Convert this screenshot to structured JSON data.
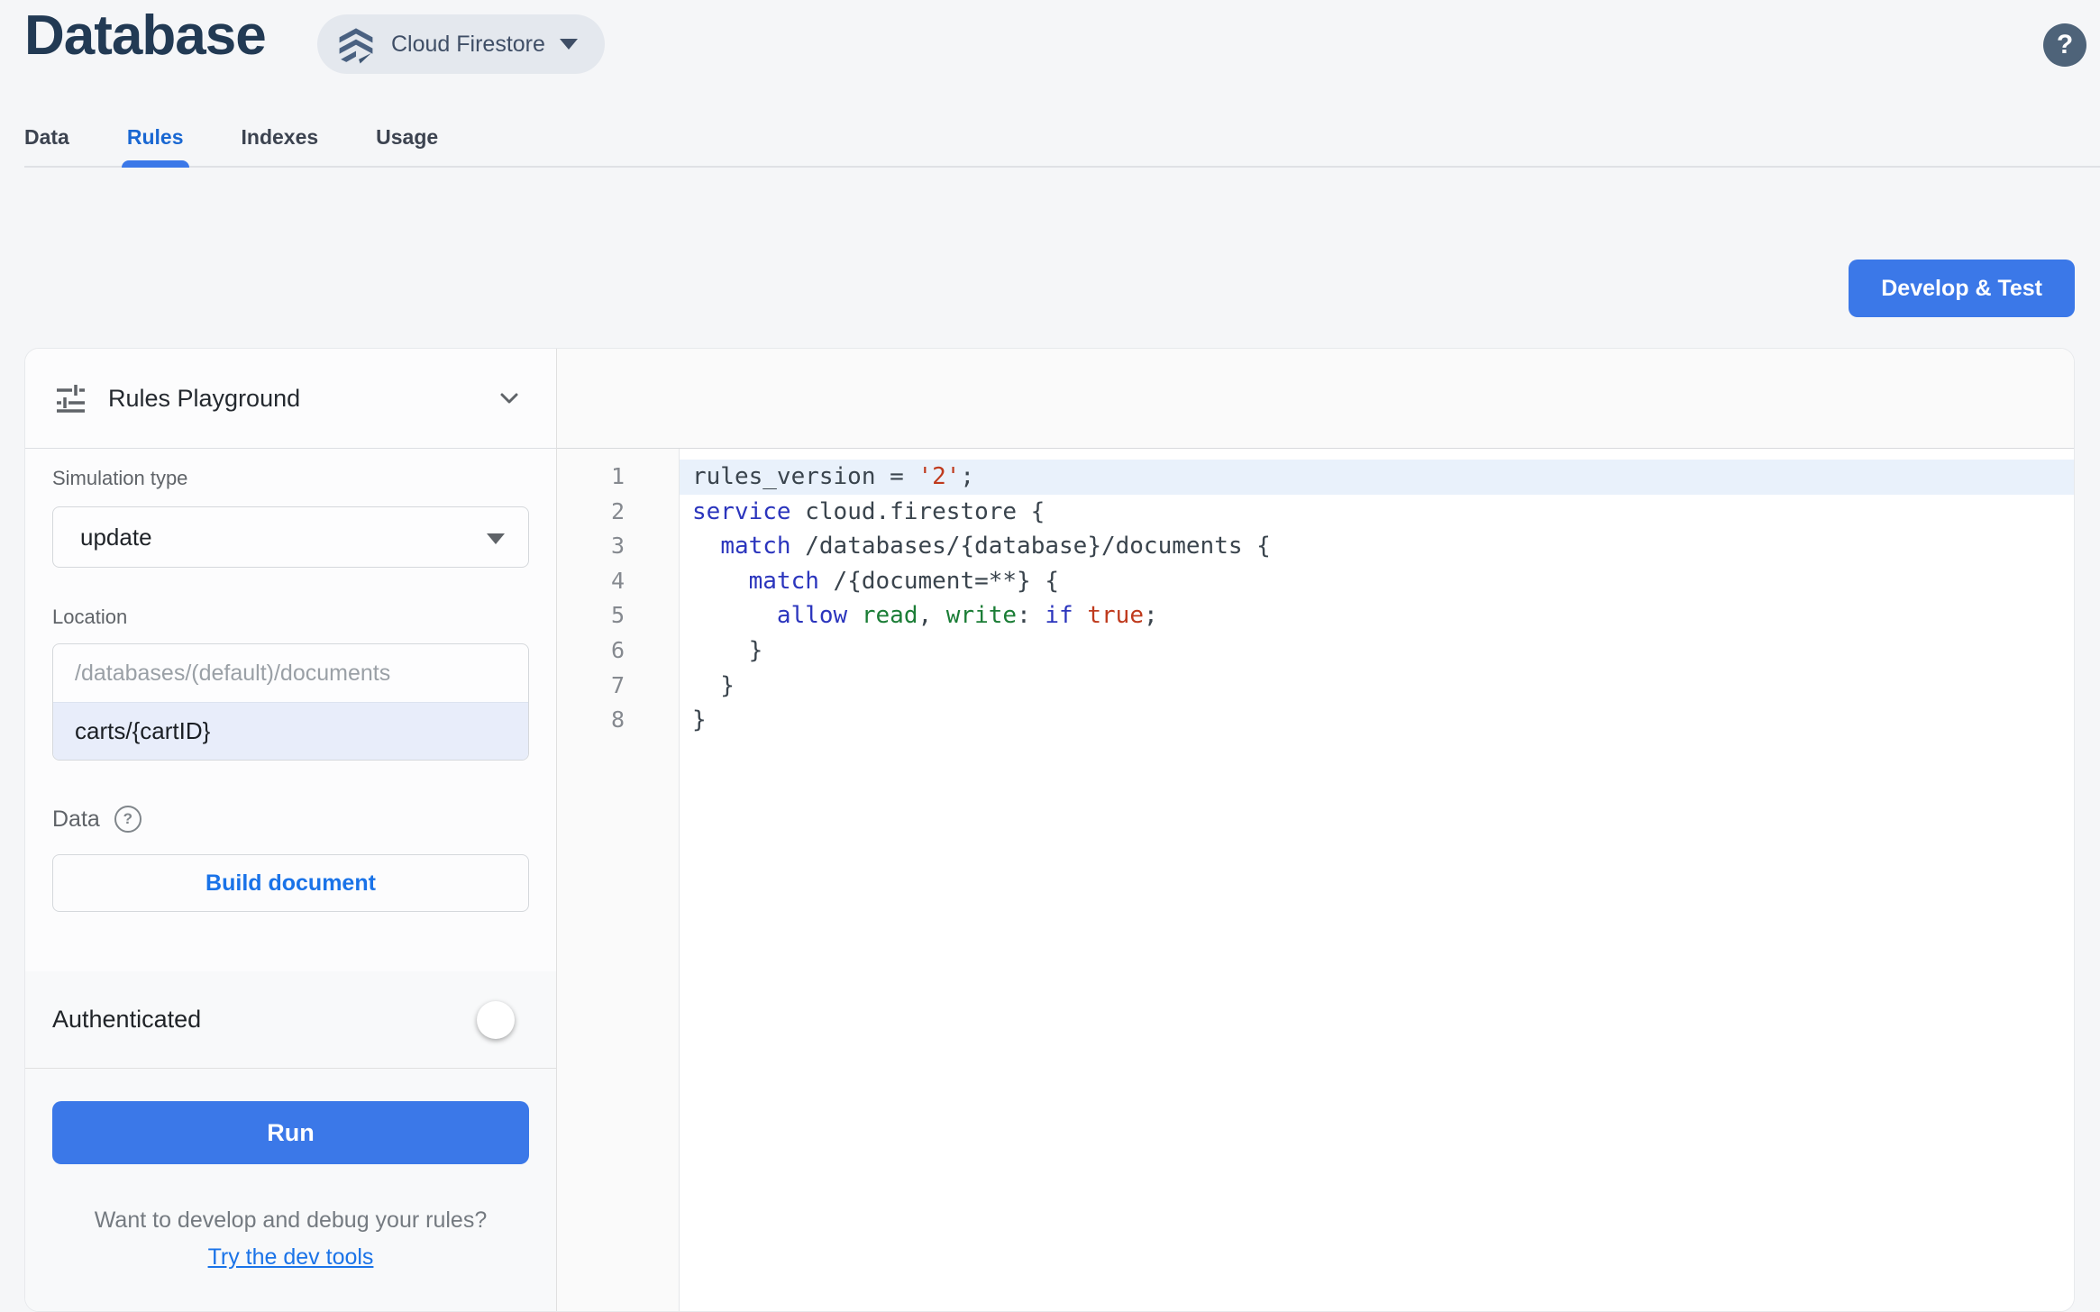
{
  "header": {
    "title": "Database",
    "product_selector": "Cloud Firestore",
    "help_glyph": "?"
  },
  "tabs": {
    "items": [
      {
        "label": "Data",
        "active": false
      },
      {
        "label": "Rules",
        "active": true
      },
      {
        "label": "Indexes",
        "active": false
      },
      {
        "label": "Usage",
        "active": false
      }
    ]
  },
  "develop_test_button": "Develop & Test",
  "playground": {
    "title": "Rules Playground",
    "simulation_type_label": "Simulation type",
    "simulation_type_value": "update",
    "location_label": "Location",
    "location_placeholder": "/databases/(default)/documents",
    "location_value": "carts/{cartID}",
    "data_label": "Data",
    "data_help_glyph": "?",
    "build_document_button": "Build document",
    "authenticated_label": "Authenticated",
    "authenticated_state": "off",
    "run_button": "Run",
    "footer_text": "Want to develop and debug your rules?",
    "footer_link": "Try the dev tools"
  },
  "editor": {
    "lines": [
      {
        "n": "1",
        "highlight": true,
        "tokens": [
          {
            "t": "rules_version = ",
            "c": "d"
          },
          {
            "t": "'2'",
            "c": "s"
          },
          {
            "t": ";",
            "c": "d"
          }
        ]
      },
      {
        "n": "2",
        "highlight": false,
        "tokens": [
          {
            "t": "service",
            "c": "k"
          },
          {
            "t": " cloud.firestore {",
            "c": "d"
          }
        ]
      },
      {
        "n": "3",
        "highlight": false,
        "tokens": [
          {
            "t": "  ",
            "c": "d"
          },
          {
            "t": "match",
            "c": "k"
          },
          {
            "t": " /databases/{database}/documents {",
            "c": "d"
          }
        ]
      },
      {
        "n": "4",
        "highlight": false,
        "tokens": [
          {
            "t": "    ",
            "c": "d"
          },
          {
            "t": "match",
            "c": "k"
          },
          {
            "t": " /{document=**} {",
            "c": "d"
          }
        ]
      },
      {
        "n": "5",
        "highlight": false,
        "tokens": [
          {
            "t": "      ",
            "c": "d"
          },
          {
            "t": "allow",
            "c": "k"
          },
          {
            "t": " ",
            "c": "d"
          },
          {
            "t": "read",
            "c": "g"
          },
          {
            "t": ", ",
            "c": "d"
          },
          {
            "t": "write",
            "c": "g"
          },
          {
            "t": ": ",
            "c": "d"
          },
          {
            "t": "if",
            "c": "k"
          },
          {
            "t": " ",
            "c": "d"
          },
          {
            "t": "true",
            "c": "s"
          },
          {
            "t": ";",
            "c": "d"
          }
        ]
      },
      {
        "n": "6",
        "highlight": false,
        "tokens": [
          {
            "t": "    }",
            "c": "d"
          }
        ]
      },
      {
        "n": "7",
        "highlight": false,
        "tokens": [
          {
            "t": "  }",
            "c": "d"
          }
        ]
      },
      {
        "n": "8",
        "highlight": false,
        "tokens": [
          {
            "t": "}",
            "c": "d"
          }
        ]
      }
    ]
  },
  "colors": {
    "accent_blue": "#3b78e8",
    "link_blue": "#1a73e8",
    "active_tab_blue": "#1967d2",
    "slate_icon": "#4a6181",
    "title_navy": "#223a54",
    "code_keyword": "#2b35bd",
    "code_string": "#bf3a1d",
    "code_identifier_green": "#1b7d36",
    "code_default": "#3a444d",
    "line_highlight": "#e9f1fb",
    "chip_background": "#e4e8ee"
  }
}
